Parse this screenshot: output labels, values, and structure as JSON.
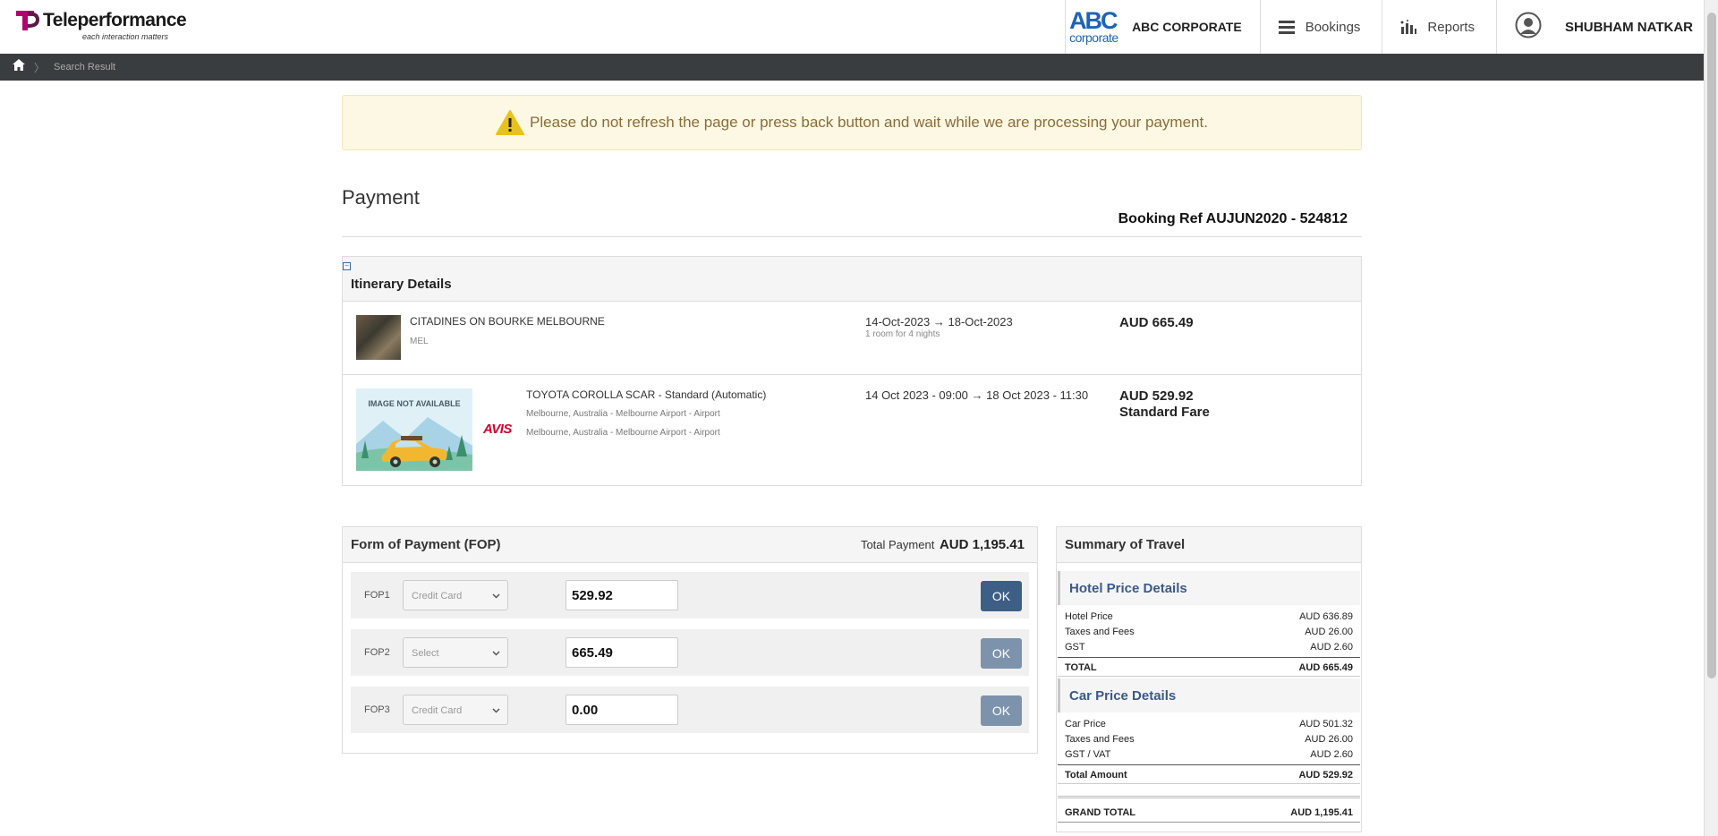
{
  "header": {
    "logo_text": "Teleperformance",
    "logo_tagline": "each interaction matters",
    "corp_logo_abc": "ABC",
    "corp_logo_sub": "corporate",
    "corp_name": "ABC CORPORATE",
    "nav_bookings": "Bookings",
    "nav_reports": "Reports",
    "user_name": "SHUBHAM NATKAR",
    "brand_color": "#b4006f"
  },
  "breadcrumb": {
    "current": "Search Result"
  },
  "alert": {
    "message": "Please do not refresh the page or press back button and wait while we are processing your payment."
  },
  "page": {
    "title": "Payment",
    "booking_ref": "Booking Ref AUJUN2020 - 524812"
  },
  "itinerary": {
    "title": "Itinerary Details",
    "hotel": {
      "name": "CITADINES ON BOURKE MELBOURNE",
      "code": "MEL",
      "dates": "14-Oct-2023 → 18-Oct-2023",
      "rooms": "1 room for 4 nights",
      "price": "AUD 665.49"
    },
    "car": {
      "image_text": "IMAGE NOT AVAILABLE",
      "vendor": "AVIS",
      "name": "TOYOTA COROLLA SCAR - Standard (Automatic)",
      "pickup": "Melbourne, Australia - Melbourne Airport - Airport",
      "dropoff": "Melbourne, Australia - Melbourne Airport - Airport",
      "dates": "14 Oct 2023 - 09:00 → 18 Oct 2023 - 11:30",
      "price": "AUD 529.92",
      "fare": "Standard Fare"
    }
  },
  "fop": {
    "title": "Form of Payment (FOP)",
    "total_label": "Total Payment",
    "total_value": "AUD 1,195.41",
    "lines": [
      {
        "label": "FOP1",
        "type": "Credit Card",
        "amount": "529.92",
        "ok": "OK",
        "ok_color": "#3e5f85"
      },
      {
        "label": "FOP2",
        "type": "Select",
        "amount": "665.49",
        "ok": "OK",
        "ok_color": "#7d93ac"
      },
      {
        "label": "FOP3",
        "type": "Credit Card",
        "amount": "0.00",
        "ok": "OK",
        "ok_color": "#7d93ac"
      }
    ]
  },
  "summary": {
    "title": "Summary of Travel",
    "hotel": {
      "title": "Hotel Price Details",
      "rows": [
        {
          "label": "Hotel Price",
          "value": "AUD 636.89"
        },
        {
          "label": "Taxes and Fees",
          "value": "AUD 26.00"
        },
        {
          "label": "GST",
          "value": "AUD 2.60"
        }
      ],
      "total_label": "TOTAL",
      "total_value": "AUD 665.49"
    },
    "car": {
      "title": "Car Price Details",
      "rows": [
        {
          "label": "Car Price",
          "value": "AUD 501.32"
        },
        {
          "label": "Taxes and Fees",
          "value": "AUD 26.00"
        },
        {
          "label": "GST / VAT",
          "value": "AUD 2.60"
        }
      ],
      "total_label": "Total Amount",
      "total_value": "AUD 529.92"
    },
    "grand_label": "GRAND TOTAL",
    "grand_value": "AUD 1,195.41"
  }
}
